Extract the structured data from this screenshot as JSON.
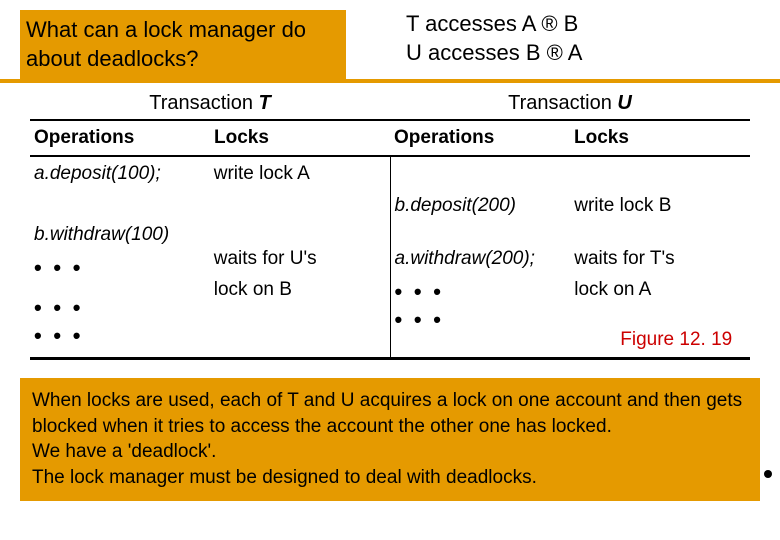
{
  "header": {
    "question_l1": "What can a lock manager do",
    "question_l2": "about deadlocks?",
    "access_l1": "T accesses A ® B",
    "access_l2": "U accesses B ® A"
  },
  "trans_headers": {
    "left_prefix": "Transaction ",
    "left_name": "T",
    "right_prefix": "Transaction ",
    "right_name": "U"
  },
  "col_headers": {
    "ops_l": "Operations",
    "locks_l": "Locks",
    "ops_r": "Operations",
    "locks_r": "Locks"
  },
  "rows": {
    "t_op1": "a.deposit(100);",
    "t_lock1": "write lock A",
    "u_op1": "b.deposit(200)",
    "u_lock1": "write lock B",
    "t_op2": "b.withdraw(100)",
    "t_lock2a": "waits for U's",
    "t_lock2b": "lock on B",
    "u_op2": "a.withdraw(200);",
    "u_lock2a": "waits for  T's",
    "u_lock2b": "lock on A"
  },
  "ellipsis": "• • •",
  "figure": "Figure 12. 19",
  "bottom": {
    "p1": "When locks are used, each of T and U acquires a lock on one account and then gets blocked when it tries to access the account the other one has locked.",
    "p2": "We have a 'deadlock'.",
    "p3": "The lock manager must be designed to deal with deadlocks."
  }
}
